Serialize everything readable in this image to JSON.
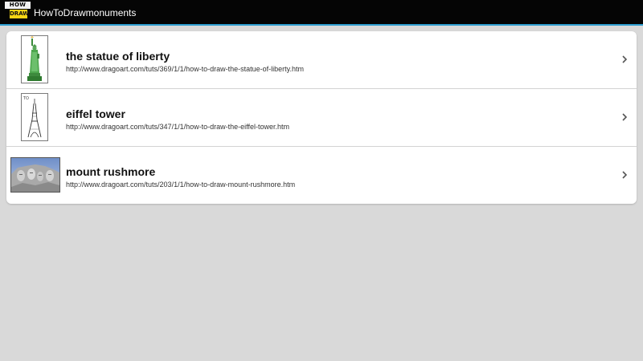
{
  "app": {
    "logo_top": "HOW TO",
    "logo_bottom": "DRAW",
    "title": "HowToDrawmonuments"
  },
  "items": [
    {
      "title": "the statue of liberty",
      "url": "http://www.dragoart.com/tuts/369/1/1/how-to-draw-the-statue-of-liberty.htm",
      "icon": "statue-of-liberty-thumbnail"
    },
    {
      "title": "eiffel tower",
      "url": "http://www.dragoart.com/tuts/347/1/1/how-to-draw-the-eiffel-tower.htm",
      "icon": "eiffel-tower-thumbnail"
    },
    {
      "title": "mount rushmore",
      "url": "http://www.dragoart.com/tuts/203/1/1/how-to-draw-mount-rushmore.htm",
      "icon": "mount-rushmore-thumbnail"
    }
  ],
  "colors": {
    "action_bar": "#050505",
    "accent": "#2e9fd1",
    "background": "#d9d9d9",
    "card": "#ffffff"
  }
}
